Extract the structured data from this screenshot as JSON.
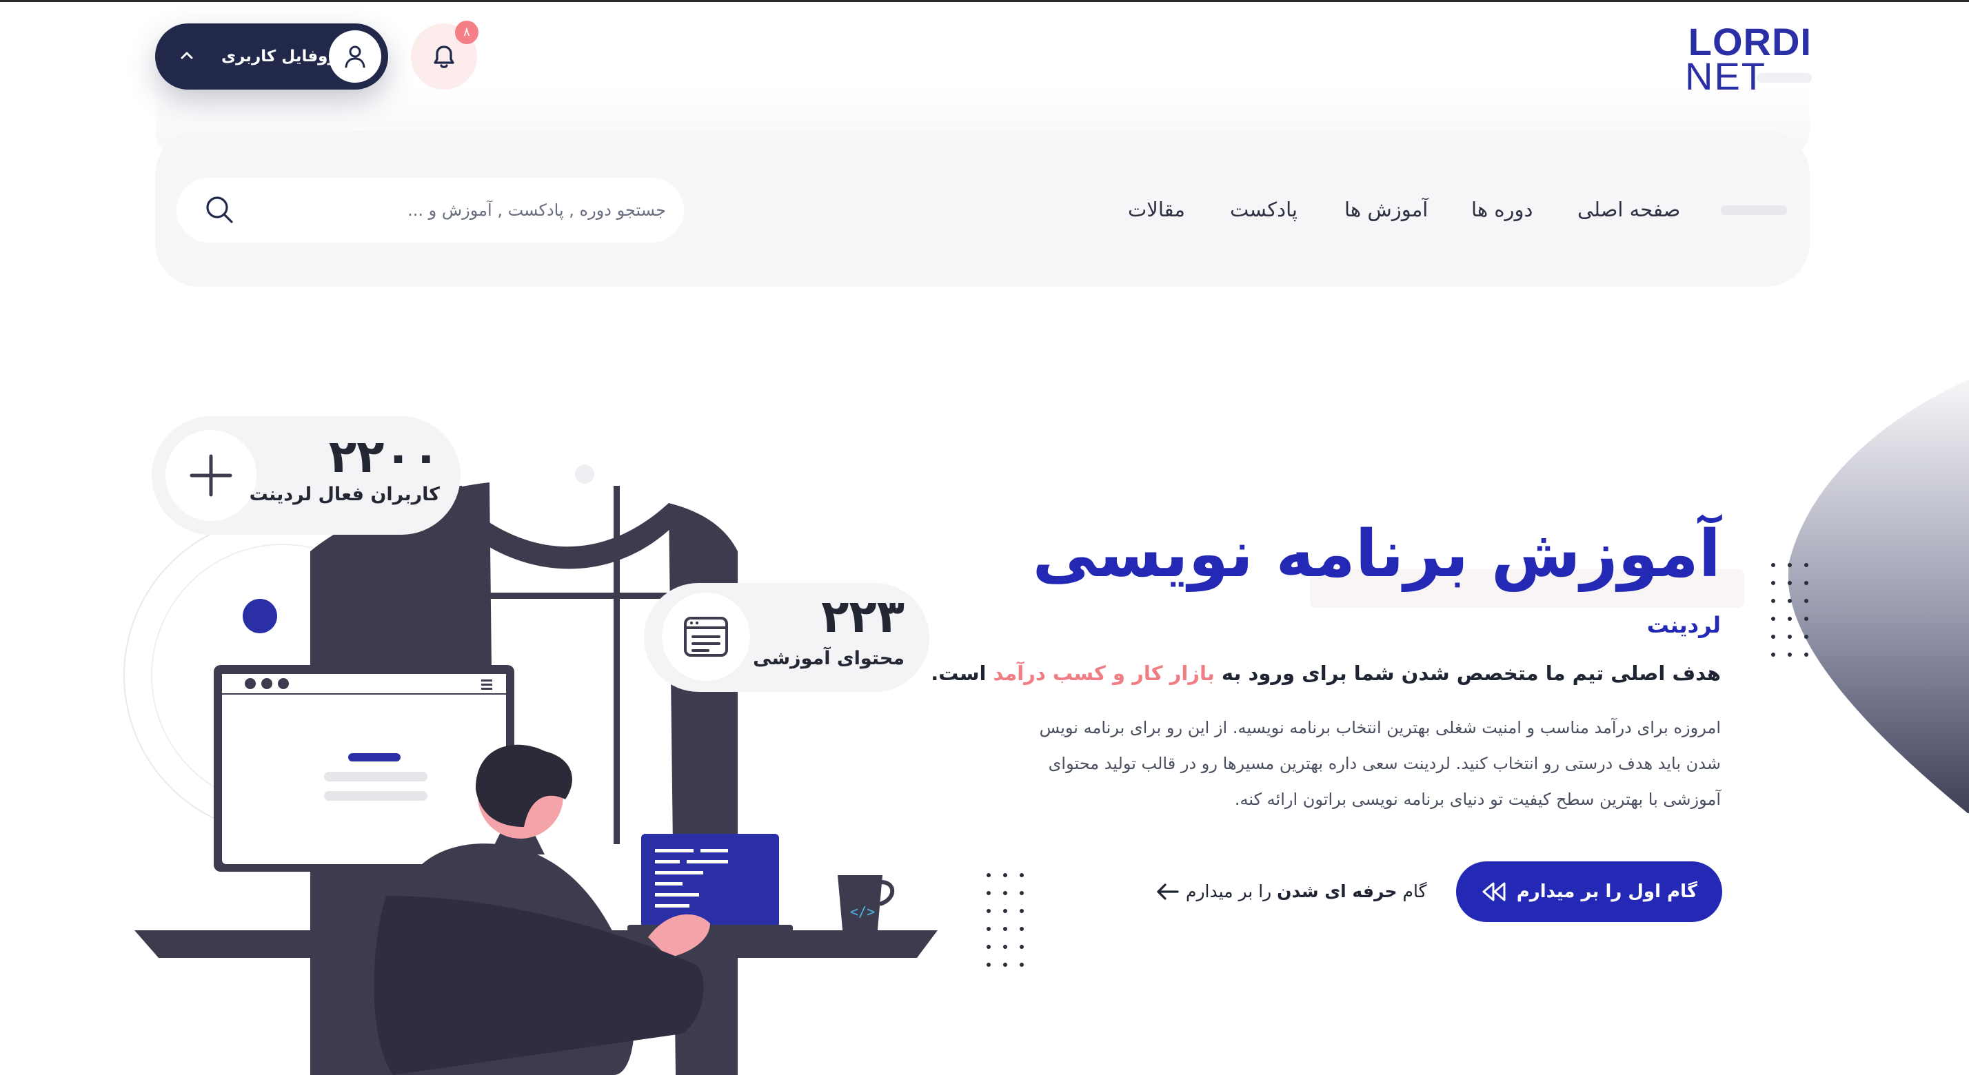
{
  "brand": {
    "line1": "LORDI",
    "line2": "NET",
    "color": "#2b2fa6"
  },
  "header": {
    "profile_label": "پروفایل کاربری",
    "notification_count": "۸",
    "search_placeholder": "جستجو دوره , پادکست , آموزش و ...",
    "nav": [
      "صفحه اصلی",
      "دوره ها",
      "آموزش ها",
      "پادکست",
      "مقالات"
    ]
  },
  "hero": {
    "title": "آموزش برنامه نویسی",
    "subtitle": "لردینت",
    "lead_before": "هدف اصلی تیم ما متخصص شدن شما برای ورود به ",
    "lead_highlight": "بازار کار و کسب درآمد",
    "lead_after": " است.",
    "paragraph": "امروزه برای درآمد مناسب و امنیت شغلی بهترین انتخاب برنامه نویسیه. از این رو برای برنامه نویس شدن باید هدف درستی رو انتخاب کنید. لردینت سعی داره بهترین مسیرها رو در قالب تولید محتوای آموزشی با بهترین سطح کیفیت تو دنیای برنامه نویسی براتون ارائه کنه.",
    "cta_label": "گام اول را بر میدارم",
    "step_before": "گام ",
    "step_bold": "حرفه ای شدن",
    "step_after": " را بر میدارم"
  },
  "stats": {
    "users_count": "۲۲۰۰",
    "users_label": "کاربران فعال لردینت",
    "content_count": "۲۲۳",
    "content_label": "محتوای آموزشی"
  },
  "colors": {
    "primary": "#2329b4",
    "dark": "#22284a",
    "accent": "#f07c84",
    "panel": "#f6f6f9"
  },
  "icons": [
    "user-icon",
    "bell-icon",
    "chevron-up-icon",
    "search-icon",
    "double-chevron-left-icon",
    "arrow-left-icon",
    "plus-icon",
    "document-icon"
  ]
}
